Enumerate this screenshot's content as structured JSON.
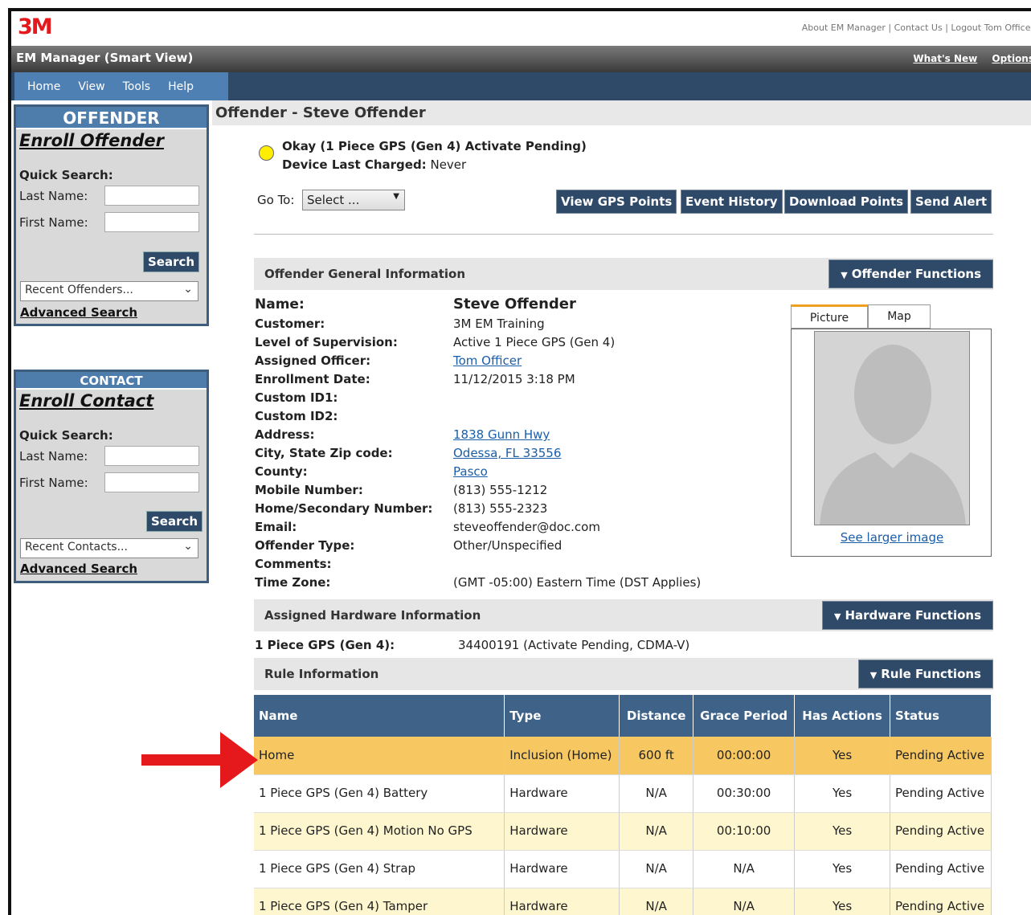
{
  "header": {
    "logo": "3M",
    "top_links": [
      "About EM Manager",
      "Contact Us",
      "Logout Tom Officer"
    ],
    "app_title": "EM Manager (Smart View)",
    "right_links": [
      "What's New",
      "Options"
    ]
  },
  "menu": [
    "Home",
    "View",
    "Tools",
    "Help"
  ],
  "offender_panel": {
    "header": "OFFENDER",
    "enroll": "Enroll Offender",
    "quick_search": "Quick Search:",
    "last_name": "Last Name:",
    "first_name": "First Name:",
    "search_button": "Search",
    "recent": "Recent Offenders...",
    "advanced": "Advanced Search"
  },
  "contact_panel": {
    "header": "CONTACT",
    "enroll": "Enroll Contact",
    "quick_search": "Quick Search:",
    "last_name": "Last Name:",
    "first_name": "First Name:",
    "search_button": "Search",
    "recent": "Recent Contacts...",
    "advanced": "Advanced Search"
  },
  "page": {
    "title": "Offender - Steve Offender",
    "status_line": "Okay (1 Piece GPS (Gen 4) Activate Pending)",
    "charged_label": "Device Last Charged:",
    "charged_value": "Never",
    "goto_label": "Go To:",
    "goto_select": "Select ...",
    "actions": [
      "View GPS Points",
      "Event History",
      "Download Points",
      "Send Alert"
    ]
  },
  "general": {
    "section_title": "Offender General Information",
    "functions_button": "Offender Functions",
    "fields": [
      {
        "label": "Name:",
        "value": "Steve Offender"
      },
      {
        "label": "Customer:",
        "value": "3M EM Training"
      },
      {
        "label": "Level of Supervision:",
        "value": "Active 1 Piece GPS (Gen 4)"
      },
      {
        "label": "Assigned Officer:",
        "value": "Tom Officer"
      },
      {
        "label": "Enrollment Date:",
        "value": "11/12/2015 3:18 PM"
      },
      {
        "label": "Custom ID1:",
        "value": ""
      },
      {
        "label": "Custom ID2:",
        "value": ""
      },
      {
        "label": "Address:",
        "value": "1838 Gunn Hwy"
      },
      {
        "label": "City, State Zip code:",
        "value": "Odessa, FL 33556"
      },
      {
        "label": "County:",
        "value": "Pasco"
      },
      {
        "label": "Mobile Number:",
        "value": "(813) 555-1212"
      },
      {
        "label": "Home/Secondary Number:",
        "value": "(813) 555-2323"
      },
      {
        "label": "Email:",
        "value": "steveoffender@doc.com"
      },
      {
        "label": "Offender Type:",
        "value": "Other/Unspecified"
      },
      {
        "label": "Comments:",
        "value": ""
      },
      {
        "label": "Time Zone:",
        "value": "(GMT -05:00) Eastern Time (DST Applies)"
      }
    ],
    "tabs": [
      "Picture",
      "Map"
    ],
    "larger_image": "See larger image"
  },
  "hardware": {
    "section_title": "Assigned Hardware Information",
    "functions_button": "Hardware Functions",
    "label": "1 Piece GPS (Gen 4):",
    "value": "34400191 (Activate Pending, CDMA-V)"
  },
  "rules": {
    "section_title": "Rule Information",
    "functions_button": "Rule Functions",
    "columns": [
      "Name",
      "Type",
      "Distance",
      "Grace Period",
      "Has Actions",
      "Status"
    ],
    "rows": [
      {
        "name": "Home",
        "type": "Inclusion (Home)",
        "distance": "600 ft",
        "grace": "00:00:00",
        "actions": "Yes",
        "status": "Pending Active"
      },
      {
        "name": "1 Piece GPS (Gen 4) Battery",
        "type": "Hardware",
        "distance": "N/A",
        "grace": "00:30:00",
        "actions": "Yes",
        "status": "Pending Active"
      },
      {
        "name": "1 Piece GPS (Gen 4) Motion No GPS",
        "type": "Hardware",
        "distance": "N/A",
        "grace": "00:10:00",
        "actions": "Yes",
        "status": "Pending Active"
      },
      {
        "name": "1 Piece GPS (Gen 4) Strap",
        "type": "Hardware",
        "distance": "N/A",
        "grace": "N/A",
        "actions": "Yes",
        "status": "Pending Active"
      },
      {
        "name": "1 Piece GPS (Gen 4) Tamper",
        "type": "Hardware",
        "distance": "N/A",
        "grace": "N/A",
        "actions": "Yes",
        "status": "Pending Active"
      }
    ]
  },
  "colors": {
    "accent": "#2f4a69",
    "highlight_row": "#f7c862",
    "alt_row": "#fdf6cf",
    "arrow": "#e5181c"
  }
}
